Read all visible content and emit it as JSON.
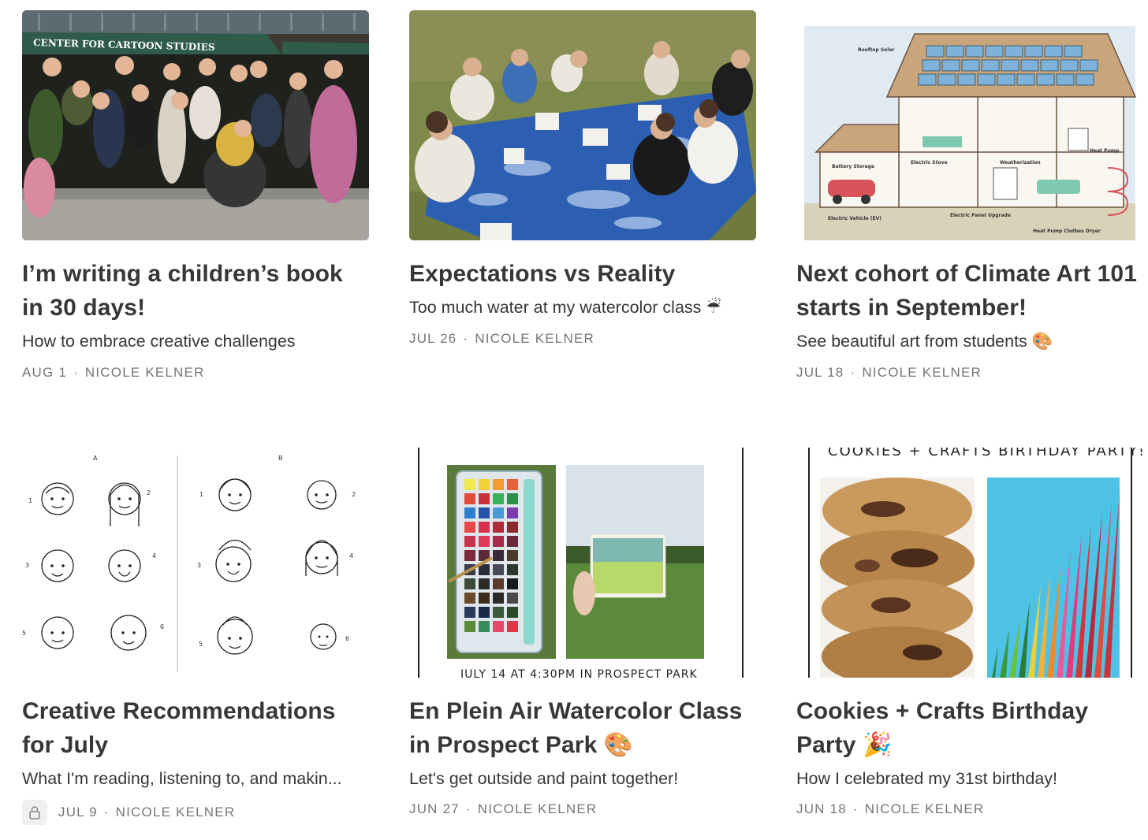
{
  "posts": [
    {
      "title": "I’m writing a children’s book in 30 days!",
      "subtitle": "How to embrace creative challenges",
      "date": "AUG 1",
      "author": "NICOLE KELNER",
      "image": {
        "banner_text": "CENTER FOR CARTOON STUDIES"
      }
    },
    {
      "title": "Expectations vs Reality",
      "subtitle": "Too much water at my watercolor class ☔",
      "date": "JUL 26",
      "author": "NICOLE KELNER"
    },
    {
      "title": "Next cohort of Climate Art 101 starts in September!",
      "subtitle": "See beautiful art from students 🎨",
      "date": "JUL 18",
      "author": "NICOLE KELNER",
      "image": {
        "labels": [
          "Rooftop Solar",
          "Battery Storage",
          "Electric Stove",
          "Weatherization",
          "Heat Pump",
          "Electric Vehicle (EV)",
          "Electric Panel Upgrade",
          "Heat Pump Clothes Dryer"
        ]
      }
    },
    {
      "title": "Creative Recommendations for July",
      "subtitle": "What I'm reading, listening to, and makin...",
      "date": "JUL 9",
      "author": "NICOLE KELNER",
      "locked": true,
      "image": {
        "col_a": "A",
        "col_b": "B",
        "nums": [
          "1",
          "2",
          "3",
          "4",
          "5",
          "6"
        ]
      }
    },
    {
      "title": "En Plein Air Watercolor Class in Prospect Park 🎨",
      "subtitle": "Let's get outside and paint together!",
      "date": "JUN 27",
      "author": "NICOLE KELNER",
      "image": {
        "bottom_text": "JULY 14 AT 4:30PM IN PROSPECT PARK"
      }
    },
    {
      "title": "Cookies + Crafts Birthday Party 🎉",
      "subtitle": "How I celebrated my 31st birthday!",
      "date": "JUN 18",
      "author": "NICOLE KELNER",
      "image": {
        "top_text": "COOKIES + CRAFTS BIRTHDAY PARTY!"
      }
    }
  ],
  "meta_separator": "·",
  "icons": {
    "lock": "lock-icon"
  }
}
